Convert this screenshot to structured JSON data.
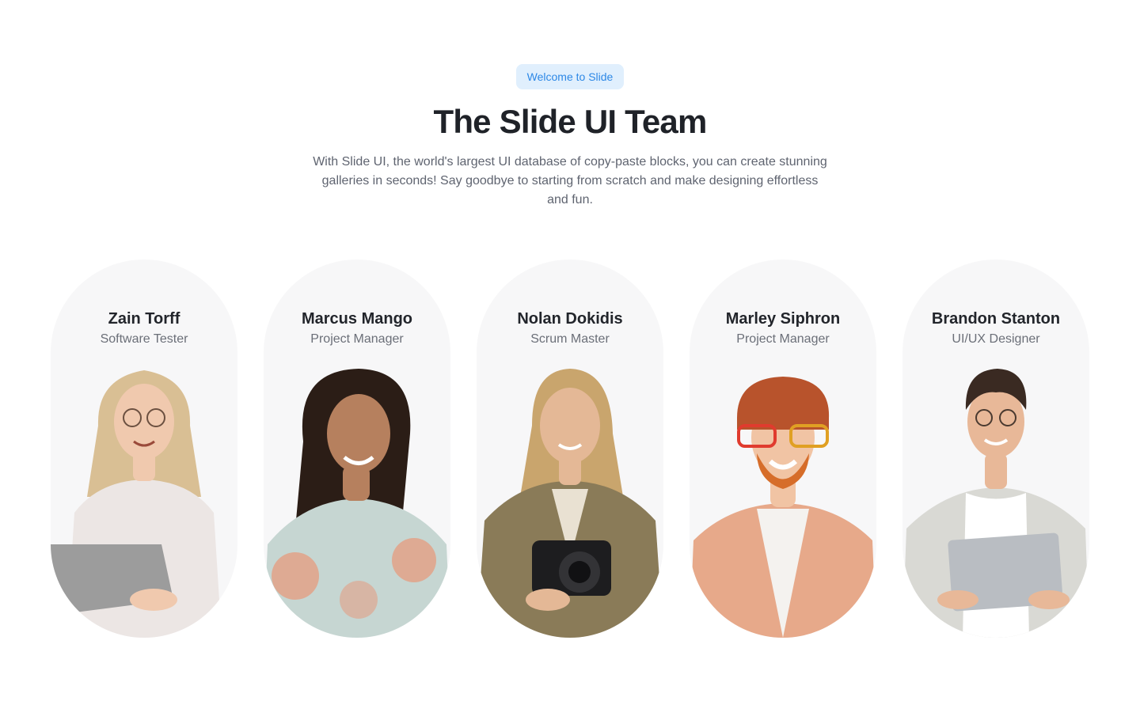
{
  "header": {
    "badge": "Welcome to Slide",
    "title": "The Slide UI Team",
    "description": "With Slide UI, the world's largest UI database of copy-paste blocks, you can create stunning galleries in seconds! Say goodbye to starting from scratch and make designing effortless and fun."
  },
  "team": [
    {
      "name": "Zain Torff",
      "role": "Software Tester",
      "colors": {
        "hair": "#d9bf94",
        "top": "#ece6e4",
        "skin": "#f0c9ae",
        "prop": "#9c9c9c"
      }
    },
    {
      "name": "Marcus Mango",
      "role": "Project Manager",
      "colors": {
        "hair": "#2b1d16",
        "top": "#c6d6d2",
        "skin": "#b6805e",
        "prop": "#e69b7d"
      }
    },
    {
      "name": "Nolan Dokidis",
      "role": "Scrum Master",
      "colors": {
        "hair": "#c9a56d",
        "top": "#8a7b58",
        "skin": "#e4b896",
        "prop": "#1d1d1f"
      }
    },
    {
      "name": "Marley Siphron",
      "role": "Project Manager",
      "colors": {
        "hair": "#d66d2a",
        "top": "#e7a98a",
        "skin": "#f1c4a4",
        "prop": "#b8532c"
      }
    },
    {
      "name": "Brandon Stanton",
      "role": "UI/UX Designer",
      "colors": {
        "hair": "#3a2a22",
        "top": "#d9d9d4",
        "skin": "#e8b898",
        "prop": "#b9bdc2"
      }
    }
  ]
}
